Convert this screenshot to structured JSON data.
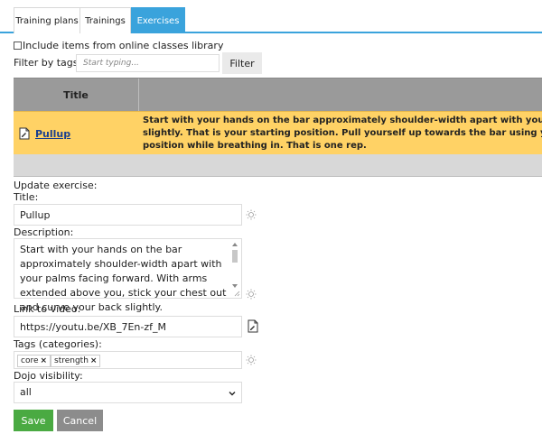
{
  "tabs": [
    {
      "label": "Training plans",
      "active": false
    },
    {
      "label": "Trainings",
      "active": false
    },
    {
      "label": "Exercises",
      "active": true
    }
  ],
  "include_library": {
    "label": "Include items from online classes library",
    "checked": false
  },
  "filter": {
    "label": "Filter by tags:",
    "placeholder": "Start typing...",
    "button": "Filter"
  },
  "table": {
    "headers": [
      "Title"
    ],
    "rows": [
      {
        "title": "Pullup",
        "description_lines": [
          "Start with your hands on the bar approximately shoulder-width apart with your pal",
          "slightly. That is your starting position. Pull yourself up towards the bar using your l",
          "position while breathing in. That is one rep."
        ]
      }
    ]
  },
  "form": {
    "heading": "Update exercise:",
    "title_label": "Title:",
    "title_value": "Pullup",
    "description_label": "Description:",
    "description_value": "Start with your hands on the bar approximately shoulder-width apart with your palms facing forward. With arms extended above you, stick your chest out and curve your back slightly.",
    "video_label": "Link to video:",
    "video_value": "https://youtu.be/XB_7En-zf_M",
    "tags_label": "Tags (categories):",
    "tags": [
      "core",
      "strength"
    ],
    "visibility_label": "Dojo visibility:",
    "visibility_value": "all",
    "save_label": "Save",
    "cancel_label": "Cancel"
  },
  "colors": {
    "accent": "#3aa3dc",
    "row_highlight": "#ffd265",
    "header_gray": "#9a9a9a",
    "save_green": "#4aaa42",
    "cancel_gray": "#8c8c8c",
    "link_blue": "#1a3f8f"
  },
  "icons": {
    "row_icon": "edit-document-icon",
    "hint_icon": "lightbulb-icon",
    "video_icon": "edit-document-icon",
    "select_icon": "chevron-down-icon"
  }
}
